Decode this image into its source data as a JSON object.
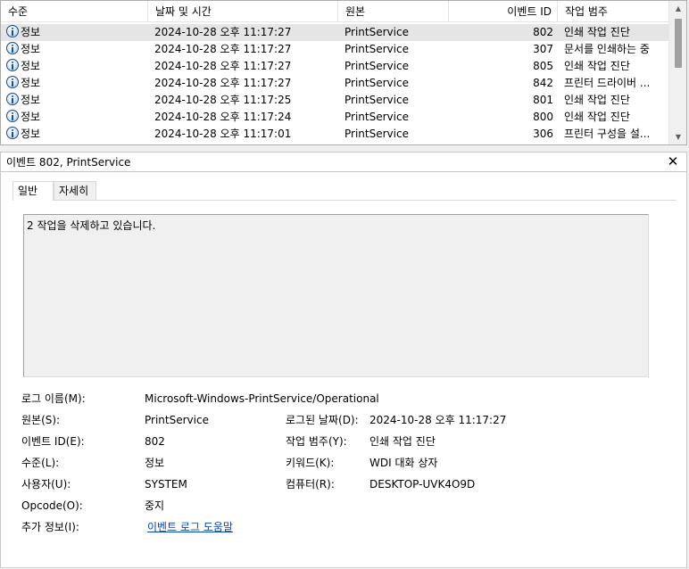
{
  "list": {
    "columns": {
      "level": "수준",
      "date": "날짜 및 시간",
      "source": "원본",
      "event_id": "이벤트 ID",
      "category": "작업 범주"
    },
    "rows": [
      {
        "level": "정보",
        "date": "2024-10-28 오후 11:17:27",
        "source": "PrintService",
        "event_id": "802",
        "category": "인쇄 작업 진단",
        "selected": true
      },
      {
        "level": "정보",
        "date": "2024-10-28 오후 11:17:27",
        "source": "PrintService",
        "event_id": "307",
        "category": "문서를 인쇄하는 중"
      },
      {
        "level": "정보",
        "date": "2024-10-28 오후 11:17:27",
        "source": "PrintService",
        "event_id": "805",
        "category": "인쇄 작업 진단"
      },
      {
        "level": "정보",
        "date": "2024-10-28 오후 11:17:27",
        "source": "PrintService",
        "event_id": "842",
        "category": "프린터 드라이버 ..."
      },
      {
        "level": "정보",
        "date": "2024-10-28 오후 11:17:25",
        "source": "PrintService",
        "event_id": "801",
        "category": "인쇄 작업 진단"
      },
      {
        "level": "정보",
        "date": "2024-10-28 오후 11:17:24",
        "source": "PrintService",
        "event_id": "800",
        "category": "인쇄 작업 진단"
      },
      {
        "level": "정보",
        "date": "2024-10-28 오후 11:17:01",
        "source": "PrintService",
        "event_id": "306",
        "category": "프린터 구성을 설..."
      }
    ],
    "row_icon": "info-icon"
  },
  "detail": {
    "title": "이벤트 802, PrintService",
    "tabs": {
      "general": "일반",
      "details": "자세히"
    },
    "message": "2 작업을 삭제하고 있습니다.",
    "fields": {
      "log_name_label": "로그 이름(M):",
      "log_name_value": "Microsoft-Windows-PrintService/Operational",
      "source_label": "원본(S):",
      "source_value": "PrintService",
      "logged_label": "로그된 날짜(D):",
      "logged_value": "2024-10-28 오후 11:17:27",
      "event_id_label": "이벤트 ID(E):",
      "event_id_value": "802",
      "task_category_label": "작업 범주(Y):",
      "task_category_value": "인쇄 작업 진단",
      "level_label": "수준(L):",
      "level_value": "정보",
      "keywords_label": "키워드(K):",
      "keywords_value": "WDI 대화 상자",
      "user_label": "사용자(U):",
      "user_value": "SYSTEM",
      "computer_label": "컴퓨터(R):",
      "computer_value": "DESKTOP-UVK4O9D",
      "opcode_label": "Opcode(O):",
      "opcode_value": "중지",
      "more_info_label": "추가 정보(I):",
      "more_info_link": "이벤트 로그 도움말"
    }
  },
  "colors": {
    "selected_row": "#e5e5e5",
    "link": "#0645ad",
    "panel_bg": "#f0f0f0"
  }
}
